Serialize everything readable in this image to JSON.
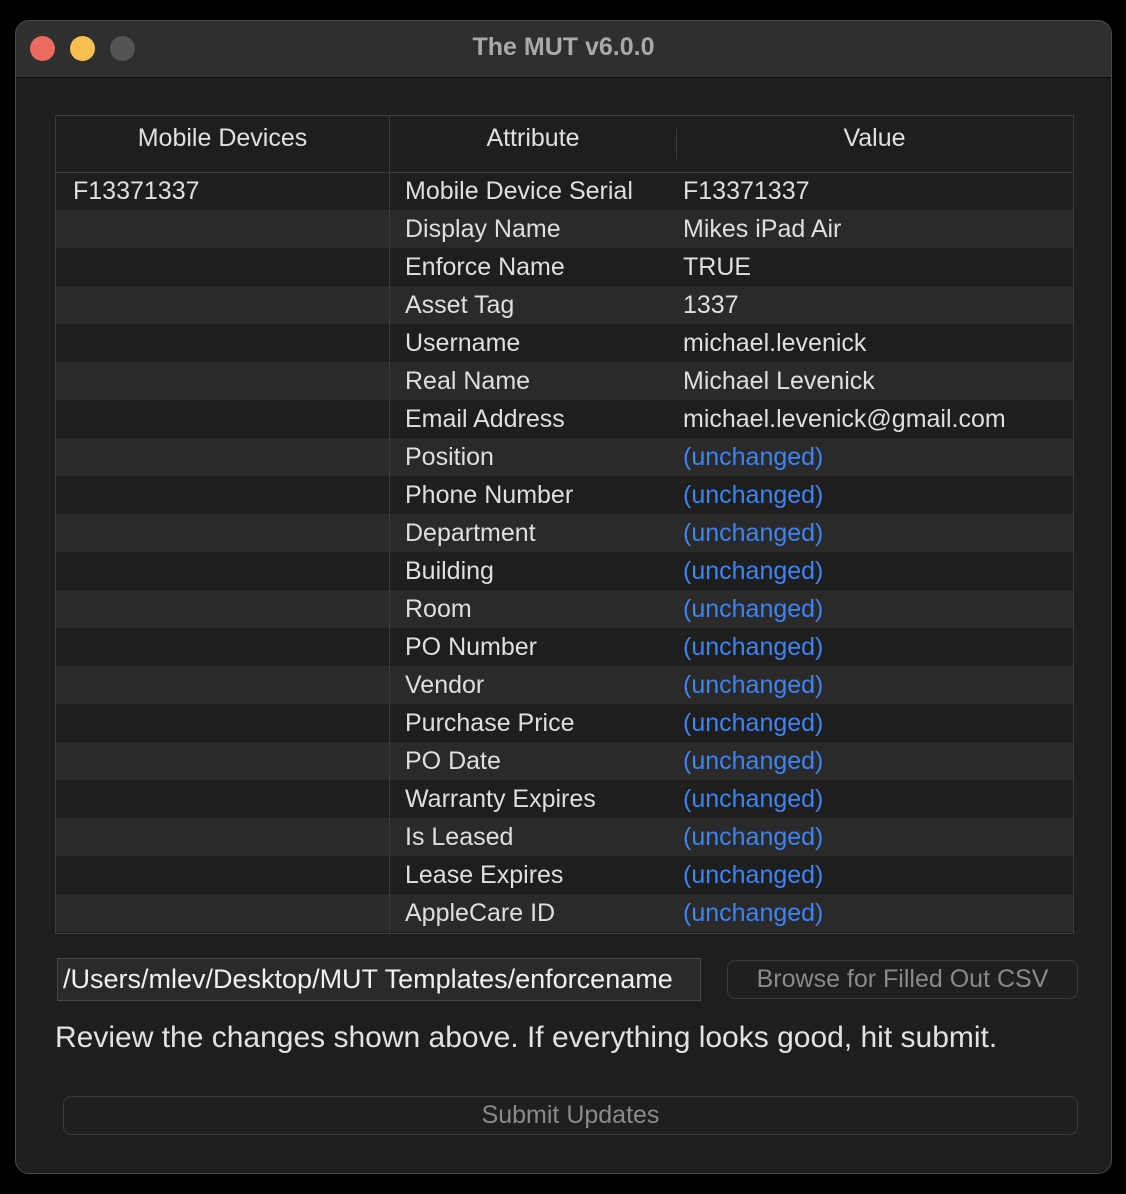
{
  "window": {
    "title": "The MUT v6.0.0"
  },
  "table": {
    "headers": {
      "devices": "Mobile Devices",
      "attribute": "Attribute",
      "value": "Value"
    },
    "devices": [
      "F13371337"
    ],
    "rows": [
      {
        "attribute": "Mobile Device Serial",
        "value": "F13371337",
        "changed": true
      },
      {
        "attribute": "Display Name",
        "value": "Mikes iPad Air",
        "changed": true
      },
      {
        "attribute": "Enforce Name",
        "value": "TRUE",
        "changed": true
      },
      {
        "attribute": "Asset Tag",
        "value": "1337",
        "changed": true
      },
      {
        "attribute": "Username",
        "value": "michael.levenick",
        "changed": true
      },
      {
        "attribute": "Real Name",
        "value": "Michael Levenick",
        "changed": true
      },
      {
        "attribute": "Email Address",
        "value": "michael.levenick@gmail.com",
        "changed": true
      },
      {
        "attribute": "Position",
        "value": "(unchanged)",
        "changed": false
      },
      {
        "attribute": "Phone Number",
        "value": "(unchanged)",
        "changed": false
      },
      {
        "attribute": "Department",
        "value": "(unchanged)",
        "changed": false
      },
      {
        "attribute": "Building",
        "value": "(unchanged)",
        "changed": false
      },
      {
        "attribute": "Room",
        "value": "(unchanged)",
        "changed": false
      },
      {
        "attribute": "PO Number",
        "value": "(unchanged)",
        "changed": false
      },
      {
        "attribute": "Vendor",
        "value": "(unchanged)",
        "changed": false
      },
      {
        "attribute": "Purchase Price",
        "value": "(unchanged)",
        "changed": false
      },
      {
        "attribute": "PO Date",
        "value": "(unchanged)",
        "changed": false
      },
      {
        "attribute": "Warranty Expires",
        "value": "(unchanged)",
        "changed": false
      },
      {
        "attribute": "Is Leased",
        "value": "(unchanged)",
        "changed": false
      },
      {
        "attribute": "Lease Expires",
        "value": "(unchanged)",
        "changed": false
      },
      {
        "attribute": "AppleCare ID",
        "value": "(unchanged)",
        "changed": false
      }
    ]
  },
  "file": {
    "path": "/Users/mlev/Desktop/MUT Templates/enforcename",
    "browse_label": "Browse for Filled Out CSV"
  },
  "message": "Review the changes shown above. If everything looks good, hit submit.",
  "submit_label": "Submit Updates",
  "colors": {
    "unchanged": "#3d85f5",
    "close": "#ed6a5e",
    "minimize": "#f5c04f",
    "zoom_disabled": "#545454"
  }
}
